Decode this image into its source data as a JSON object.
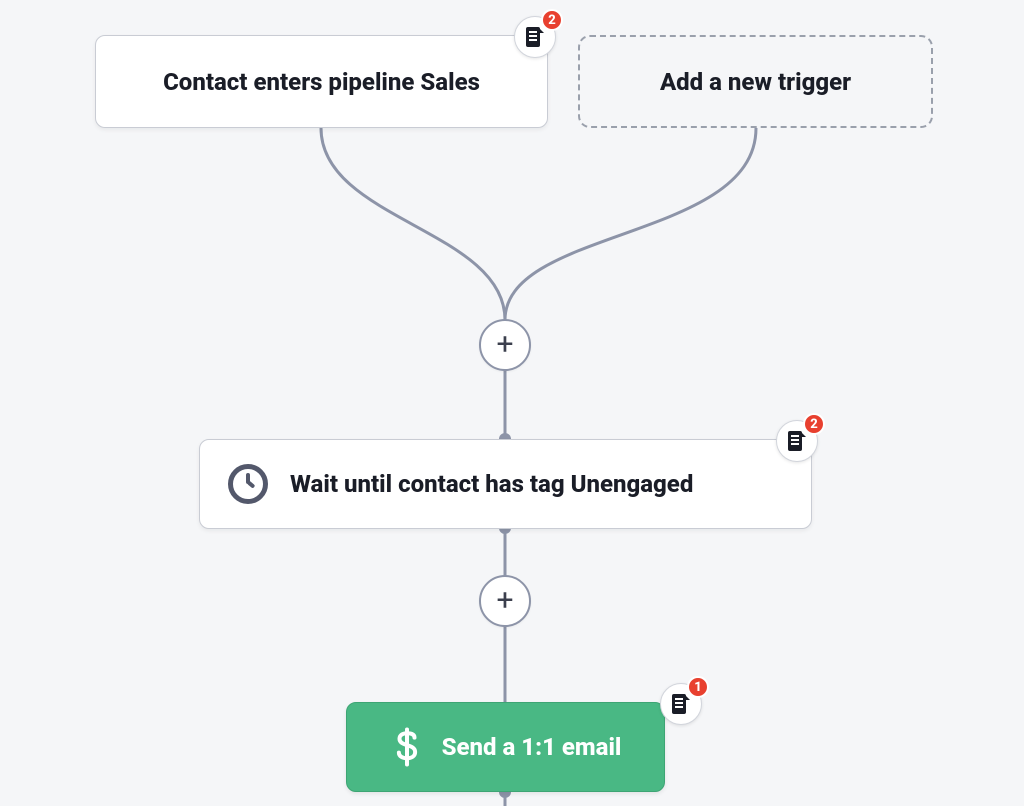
{
  "nodes": {
    "trigger1": {
      "label": "Contact enters pipeline Sales",
      "badge_count": "2"
    },
    "trigger_add": {
      "label": "Add a new trigger"
    },
    "wait": {
      "label": "Wait until contact has tag Unengaged",
      "badge_count": "2"
    },
    "action_email": {
      "label": "Send a 1:1 email",
      "badge_count": "1"
    }
  },
  "buttons": {
    "plus": "+"
  },
  "colors": {
    "connector": "#8d94a8",
    "badge_red": "#e8402f",
    "action_green": "#49b884"
  }
}
